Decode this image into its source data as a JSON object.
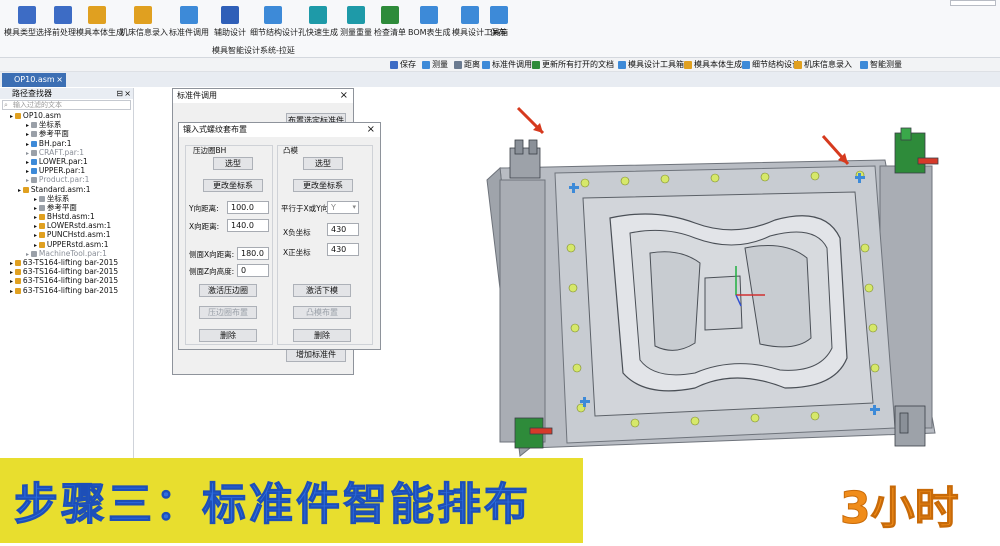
{
  "ribbon": {
    "buttons": [
      {
        "label": "模具类型选择",
        "icon": "mold-type-icon",
        "color": "#3d6cc5"
      },
      {
        "label": "前处理",
        "icon": "pin-icon",
        "color": "#3d6cc5"
      },
      {
        "label": "模具本体生成",
        "icon": "mold-body-icon",
        "color": "#e0a020"
      },
      {
        "label": "机床信息录入",
        "icon": "machine-info-icon",
        "color": "#e0a020"
      },
      {
        "label": "标准件调用",
        "icon": "cube-icon",
        "color": "#3d8ad8"
      },
      {
        "label": "辅助设计",
        "icon": "assist-design-icon",
        "color": "#2f5fb8"
      },
      {
        "label": "细节结构设计",
        "icon": "detail-structure-icon",
        "color": "#3d8ad8"
      },
      {
        "label": "孔快速生成",
        "icon": "hole-generate-icon",
        "color": "#1e9aa8"
      },
      {
        "label": "测量重量",
        "icon": "weight-measure-icon",
        "color": "#1e9aa8"
      },
      {
        "label": "检查清单",
        "icon": "checkmark-icon",
        "color": "#2e8b3a"
      },
      {
        "label": "BOM表生成",
        "icon": "bom-table-icon",
        "color": "#3d8ad8"
      },
      {
        "label": "模具设计工具箱",
        "icon": "toolbox-icon",
        "color": "#3d8ad8"
      },
      {
        "label": "保存",
        "icon": "save-icon",
        "color": "#3d8ad8"
      }
    ],
    "subtitle": "模具智能设计系统-拉延",
    "top_right_dropdown": "..."
  },
  "toolbar2": {
    "items": [
      {
        "label": "保存",
        "color": "#3d6cc5"
      },
      {
        "label": "测量",
        "color": "#3d8ad8"
      },
      {
        "label": "距离",
        "color": "#6a7a90"
      },
      {
        "label": "标准件调用",
        "color": "#3d8ad8"
      },
      {
        "label": "更新所有打开的文档",
        "color": "#2e8b3a"
      },
      {
        "label": "模具设计工具箱",
        "color": "#3d8ad8"
      },
      {
        "label": "模具本体生成",
        "color": "#e0a020"
      },
      {
        "label": "细节结构设计",
        "color": "#3d8ad8"
      },
      {
        "label": "机床信息录入",
        "color": "#e0a020"
      },
      {
        "label": "智能测量",
        "color": "#3d8ad8"
      }
    ]
  },
  "tab": {
    "label": "OP10.asm"
  },
  "tree": {
    "title": "路径查找器",
    "search_placeholder": "输入过滤的文本",
    "nodes": [
      {
        "label": "OP10.asm",
        "indent": 1,
        "gray": false,
        "color": "#e0a020"
      },
      {
        "label": "坐标系",
        "indent": 3,
        "gray": false,
        "color": "#9aa0a8"
      },
      {
        "label": "参考平面",
        "indent": 3,
        "gray": false,
        "color": "#9aa0a8"
      },
      {
        "label": "BH.par:1",
        "indent": 3,
        "gray": false,
        "color": "#3d8ad8"
      },
      {
        "label": "CRAFT.par:1",
        "indent": 3,
        "gray": true,
        "color": "#9aa0a8"
      },
      {
        "label": "LOWER.par:1",
        "indent": 3,
        "gray": false,
        "color": "#3d8ad8"
      },
      {
        "label": "UPPER.par:1",
        "indent": 3,
        "gray": false,
        "color": "#3d8ad8"
      },
      {
        "label": "Product.par:1",
        "indent": 3,
        "gray": true,
        "color": "#9aa0a8"
      },
      {
        "label": "Standard.asm:1",
        "indent": 2,
        "gray": false,
        "color": "#e0a020"
      },
      {
        "label": "坐标系",
        "indent": 4,
        "gray": false,
        "color": "#9aa0a8"
      },
      {
        "label": "参考平面",
        "indent": 4,
        "gray": false,
        "color": "#9aa0a8"
      },
      {
        "label": "BHstd.asm:1",
        "indent": 4,
        "gray": false,
        "color": "#e0a020"
      },
      {
        "label": "LOWERstd.asm:1",
        "indent": 4,
        "gray": false,
        "color": "#e0a020"
      },
      {
        "label": "PUNCHstd.asm:1",
        "indent": 4,
        "gray": false,
        "color": "#e0a020"
      },
      {
        "label": "UPPERstd.asm:1",
        "indent": 4,
        "gray": false,
        "color": "#e0a020"
      },
      {
        "label": "MachineTool.par:1",
        "indent": 3,
        "gray": true,
        "color": "#9aa0a8"
      },
      {
        "label": "63-TS164-lifting bar-2015",
        "indent": 1,
        "gray": false,
        "color": "#e0a020"
      },
      {
        "label": "63-TS164-lifting bar-2015",
        "indent": 1,
        "gray": false,
        "color": "#e0a020"
      },
      {
        "label": "63-TS164-lifting bar-2015",
        "indent": 1,
        "gray": false,
        "color": "#e0a020"
      },
      {
        "label": "63-TS164-lifting bar-2015",
        "indent": 1,
        "gray": false,
        "color": "#e0a020"
      }
    ]
  },
  "dialog_back": {
    "title": "标准件调用",
    "btn_top": "布置选定标准件",
    "btn_bottom": "增加标准件"
  },
  "dialog_front": {
    "title": "镶入式螺纹套布置",
    "left_group": "压边圈BH",
    "right_group": "凸模",
    "select_btn": "选型",
    "change_coord_btn": "更改坐标系",
    "y_spacing_label": "Y向距离:",
    "y_spacing_value": "100.0",
    "x_spacing_label": "X向距离:",
    "x_spacing_value": "140.0",
    "side_x_label": "侧面X向距离:",
    "side_x_value": "180.0",
    "side_z_label": "侧面Z向高度:",
    "side_z_value": "0",
    "select_bh_btn": "激活压边圈",
    "bh_layout_btn": "压边圈布置",
    "delete_btn": "删除",
    "parallel_label": "平行于X或Y向:",
    "parallel_value": "Y",
    "x_neg_label": "X负坐标",
    "x_neg_value": "430",
    "x_pos_label": "X正坐标",
    "x_pos_value": "430",
    "select_lower_btn": "激活下模",
    "punch_layout_btn": "凸模布置"
  },
  "banner": {
    "text": "步骤三：标准件智能排布",
    "bg_color": "#e8de2e",
    "text_color": "#2f6fe0"
  },
  "duration": {
    "text": "3小时",
    "color": "#f08c1a"
  }
}
